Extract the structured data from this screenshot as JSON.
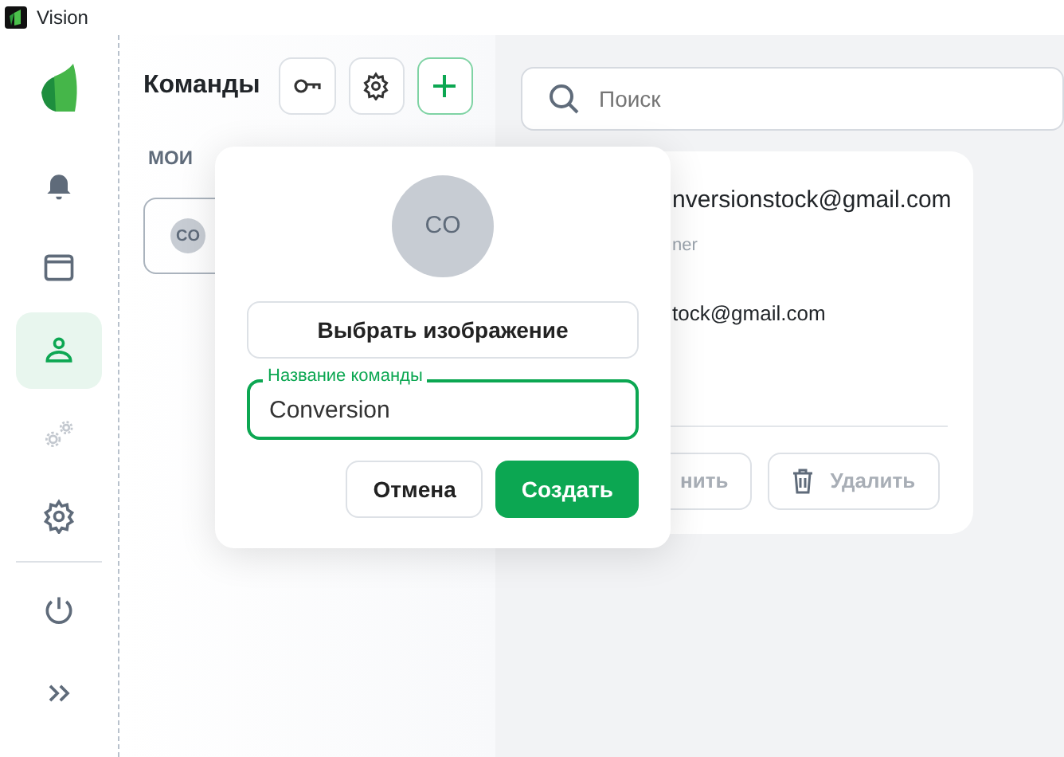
{
  "window": {
    "title": "Vision"
  },
  "sidebar": {
    "items": [
      {
        "kind": "bell",
        "selected": false,
        "disabled": false
      },
      {
        "kind": "window",
        "selected": false,
        "disabled": false
      },
      {
        "kind": "user",
        "selected": true,
        "disabled": false
      },
      {
        "kind": "gears",
        "selected": false,
        "disabled": true
      },
      {
        "kind": "gear",
        "selected": false,
        "disabled": false
      },
      {
        "kind": "power",
        "selected": false,
        "disabled": false
      },
      {
        "kind": "expand",
        "selected": false,
        "disabled": false
      }
    ]
  },
  "teams_panel": {
    "title": "Команды",
    "section": "МОИ",
    "teams": [
      {
        "avatar": "CO"
      }
    ]
  },
  "search": {
    "placeholder": "Поиск"
  },
  "member_card": {
    "email": "nversionstock@gmail.com",
    "role": "ner",
    "contact": "tock@gmail.com",
    "buttons": [
      "нить",
      "Удалить"
    ]
  },
  "popover": {
    "avatar": "CO",
    "choose_image": "Выбрать изображение",
    "name_field": {
      "label": "Название команды",
      "value": "Conversion"
    },
    "cancel": "Отмена",
    "create": "Создать"
  }
}
